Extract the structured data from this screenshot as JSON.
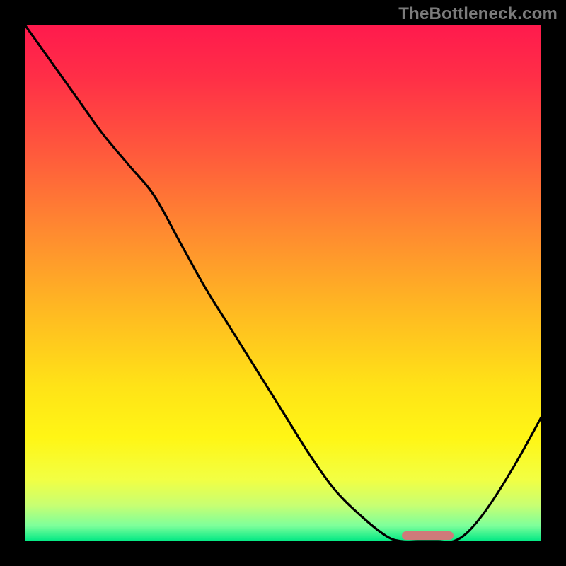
{
  "watermark": "TheBottleneck.com",
  "colors": {
    "frame": "#000000",
    "curve": "#000000",
    "marker": "#cf7a7a",
    "gradient_stops": [
      {
        "offset": 0.0,
        "color": "#ff1a4d"
      },
      {
        "offset": 0.1,
        "color": "#ff2e47"
      },
      {
        "offset": 0.25,
        "color": "#ff5a3c"
      },
      {
        "offset": 0.4,
        "color": "#ff8a30"
      },
      {
        "offset": 0.55,
        "color": "#ffb822"
      },
      {
        "offset": 0.7,
        "color": "#ffe317"
      },
      {
        "offset": 0.8,
        "color": "#fff615"
      },
      {
        "offset": 0.88,
        "color": "#f2ff43"
      },
      {
        "offset": 0.93,
        "color": "#c8ff72"
      },
      {
        "offset": 0.97,
        "color": "#7dff9b"
      },
      {
        "offset": 1.0,
        "color": "#00e884"
      }
    ]
  },
  "chart_data": {
    "type": "line",
    "title": "",
    "xlabel": "",
    "ylabel": "",
    "xlim": [
      0,
      100
    ],
    "ylim": [
      0,
      100
    ],
    "grid": false,
    "legend": false,
    "series": [
      {
        "name": "bottleneck-curve",
        "x": [
          0,
          5,
          10,
          15,
          20,
          25,
          30,
          35,
          40,
          45,
          50,
          55,
          60,
          65,
          70,
          73,
          76,
          80,
          83,
          86,
          90,
          95,
          100
        ],
        "y": [
          100,
          93,
          86,
          79,
          73,
          67,
          58,
          49,
          41,
          33,
          25,
          17,
          10,
          5,
          1,
          0,
          0,
          0,
          0,
          2,
          7,
          15,
          24
        ]
      }
    ],
    "annotations": [
      {
        "name": "optimal-region",
        "x_start": 73,
        "x_end": 83,
        "y": 0
      }
    ]
  }
}
